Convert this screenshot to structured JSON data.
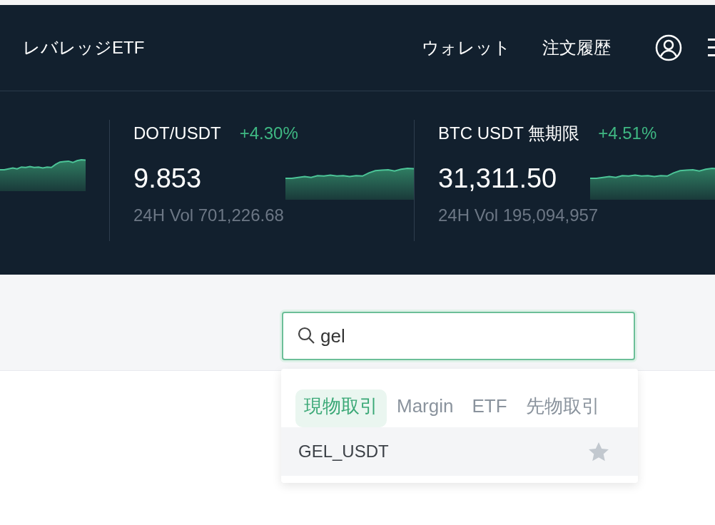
{
  "nav": {
    "title": "レバレッジETF",
    "links": [
      "ウォレット",
      "注文履歴"
    ]
  },
  "ticker": {
    "leading_sparkline": true,
    "items": [
      {
        "pair": "DOT/USDT",
        "change": "+4.30%",
        "price": "9.853",
        "volume_label": "24H Vol",
        "volume": "701,226.68"
      },
      {
        "pair": "BTC USDT 無期限",
        "change": "+4.51%",
        "price": "31,311.50",
        "volume_label": "24H Vol",
        "volume": "195,094,957"
      }
    ]
  },
  "search": {
    "value": "gel"
  },
  "results": {
    "tabs": [
      {
        "label": "現物取引",
        "selected": true
      },
      {
        "label": "Margin",
        "selected": false
      },
      {
        "label": "ETF",
        "selected": false
      },
      {
        "label": "先物取引",
        "selected": false
      }
    ],
    "rows": [
      {
        "symbol": "GEL_USDT",
        "favorite": false
      }
    ]
  }
}
